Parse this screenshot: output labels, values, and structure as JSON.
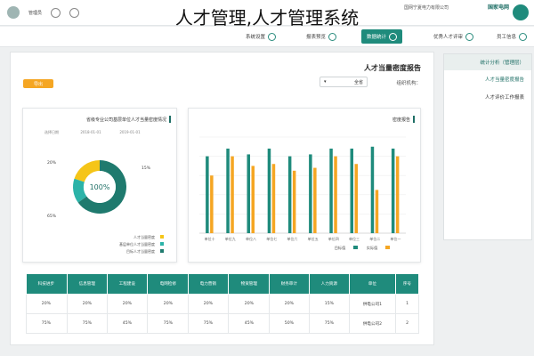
{
  "watermark": "人才管理,人才管理系统",
  "header": {
    "brand_line1": "国家电网",
    "brand_line2": "国网宁夏电力有限公司",
    "user_name": "管理员"
  },
  "nav": {
    "items": [
      {
        "label": "员工信息",
        "active": false
      },
      {
        "label": "优秀人才评审",
        "active": false
      },
      {
        "label": "数据统计",
        "active": true
      },
      {
        "label": "报表预览",
        "active": false
      },
      {
        "label": "系统设置",
        "active": false
      }
    ]
  },
  "sidebar": {
    "heading": "统计分析（管理层）",
    "items": [
      {
        "label": "人才当量密度报告",
        "active": true
      },
      {
        "label": "人才评价工作报表",
        "active": false
      }
    ]
  },
  "main": {
    "title": "人才当量密度报告",
    "org_label": "组织机构：",
    "select_value": "全省",
    "export_label": "导出"
  },
  "bar_card": {
    "title": "密度报告",
    "legend": [
      "实际值",
      "目标值"
    ]
  },
  "donut_card": {
    "title": "省级专业公司基层单位人才当量密度情况",
    "toolbar": [
      "选择日期",
      "2018-01-01",
      "2019-01-01"
    ],
    "center_label": "100%",
    "callouts": [
      "20%",
      "15%",
      "65%"
    ],
    "legend": [
      "人才当量密度",
      "基层单位人才当量密度",
      "目标人才当量密度"
    ]
  },
  "chart_data": [
    {
      "type": "bar",
      "title": "密度报告",
      "categories": [
        "单位一",
        "单位二",
        "单位三",
        "单位四",
        "单位五",
        "单位六",
        "单位七",
        "单位八",
        "单位九",
        "单位十"
      ],
      "series": [
        {
          "name": "实际值",
          "values": [
            0.8,
            0.45,
            0.72,
            0.8,
            0.68,
            0.65,
            0.72,
            0.7,
            0.8,
            0.6
          ]
        },
        {
          "name": "目标值",
          "values": [
            0.88,
            0.9,
            0.88,
            0.88,
            0.82,
            0.8,
            0.88,
            0.82,
            0.88,
            0.8
          ]
        }
      ],
      "ylim": [
        0,
        1
      ],
      "colors": [
        "#f5a623",
        "#1f8b7c"
      ]
    },
    {
      "type": "pie",
      "title": "省级专业公司基层单位人才当量密度情况",
      "labels": [
        "人才当量密度",
        "基层单位人才当量密度",
        "目标人才当量密度"
      ],
      "values": [
        20,
        15,
        65
      ],
      "colors": [
        "#f5c518",
        "#2bb3a8",
        "#1f7a6e"
      ]
    }
  ],
  "table": {
    "headers": [
      "序号",
      "单位",
      "人力资源",
      "财务审计",
      "物资管理",
      "电力营销",
      "电网检修",
      "工程建设",
      "信息管理",
      "科技进步"
    ],
    "rows": [
      [
        "1",
        "供电公司1",
        "15%",
        "20%",
        "20%",
        "20%",
        "20%",
        "20%",
        "20%",
        "20%"
      ],
      [
        "2",
        "供电公司2",
        "75%",
        "50%",
        "45%",
        "75%",
        "75%",
        "45%",
        "75%",
        "75%"
      ]
    ]
  }
}
